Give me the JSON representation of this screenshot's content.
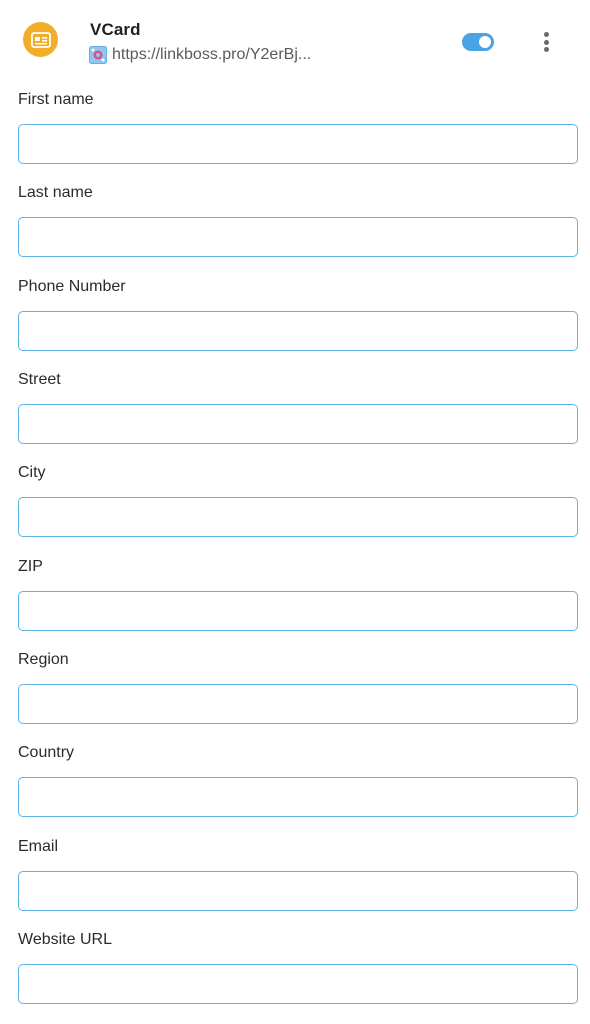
{
  "header": {
    "title": "VCard",
    "url": "https://linkboss.pro/Y2erBj...",
    "avatar_icon": "vcard-icon",
    "favicon_icon": "favicon-icon",
    "toggle_on": true,
    "menu_icon": "more-vertical-icon",
    "accent_color": "#4aa3e6",
    "avatar_color": "#f2ae2a"
  },
  "form": {
    "fields": [
      {
        "label": "First name",
        "value": "",
        "placeholder": ""
      },
      {
        "label": "Last name",
        "value": "",
        "placeholder": ""
      },
      {
        "label": "Phone Number",
        "value": "",
        "placeholder": ""
      },
      {
        "label": "Street",
        "value": "",
        "placeholder": ""
      },
      {
        "label": "City",
        "value": "",
        "placeholder": ""
      },
      {
        "label": "ZIP",
        "value": "",
        "placeholder": ""
      },
      {
        "label": "Region",
        "value": "",
        "placeholder": ""
      },
      {
        "label": "Country",
        "value": "",
        "placeholder": ""
      },
      {
        "label": "Email",
        "value": "",
        "placeholder": ""
      },
      {
        "label": "Website URL",
        "value": "",
        "placeholder": ""
      }
    ],
    "input_border_color": "#5bb3e8"
  }
}
